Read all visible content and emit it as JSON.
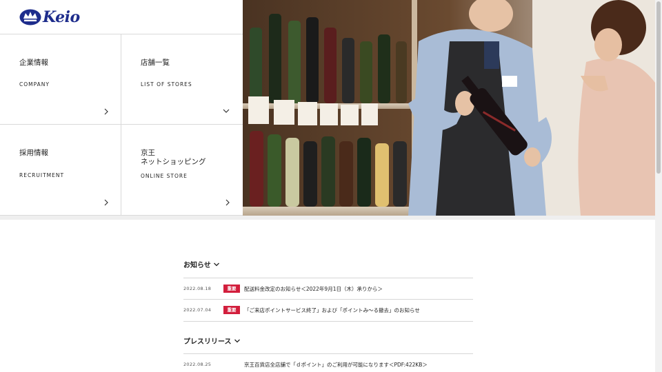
{
  "brand": {
    "name": "Keio",
    "color": "#1e2d8c"
  },
  "nav_tiles": [
    {
      "jp": "企業情報",
      "en": "COMPANY",
      "arrow": "chevron-right-icon"
    },
    {
      "jp": "店舗一覧",
      "en": "LIST OF STORES",
      "arrow": "chevron-down-icon"
    },
    {
      "jp": "採用情報",
      "en": "RECRUITMENT",
      "arrow": "chevron-right-icon"
    },
    {
      "jp": "京王\nネットショッピング",
      "en": "ONLINE STORE",
      "arrow": "chevron-right-icon"
    }
  ],
  "hero": {
    "subject": "staff-holding-wine-bottle-photo"
  },
  "news": {
    "title": "お知らせ",
    "badge_color": "#d21e3c",
    "items": [
      {
        "date": "2022.08.18",
        "badge": "重要",
        "text": "配送料金改定のお知らせ＜2022年9月1日（木）承りから＞"
      },
      {
        "date": "2022.07.04",
        "badge": "重要",
        "text": "「ご来店ポイントサービス終了」および「ポイントみ〜る撤去」のお知らせ"
      }
    ]
  },
  "press": {
    "title": "プレスリリース",
    "items": [
      {
        "date": "2022.08.25",
        "badge": "",
        "text": "京王百貨店全店舗で「ｄポイント」のご利用が可能になります＜PDF:422KB＞"
      }
    ]
  }
}
